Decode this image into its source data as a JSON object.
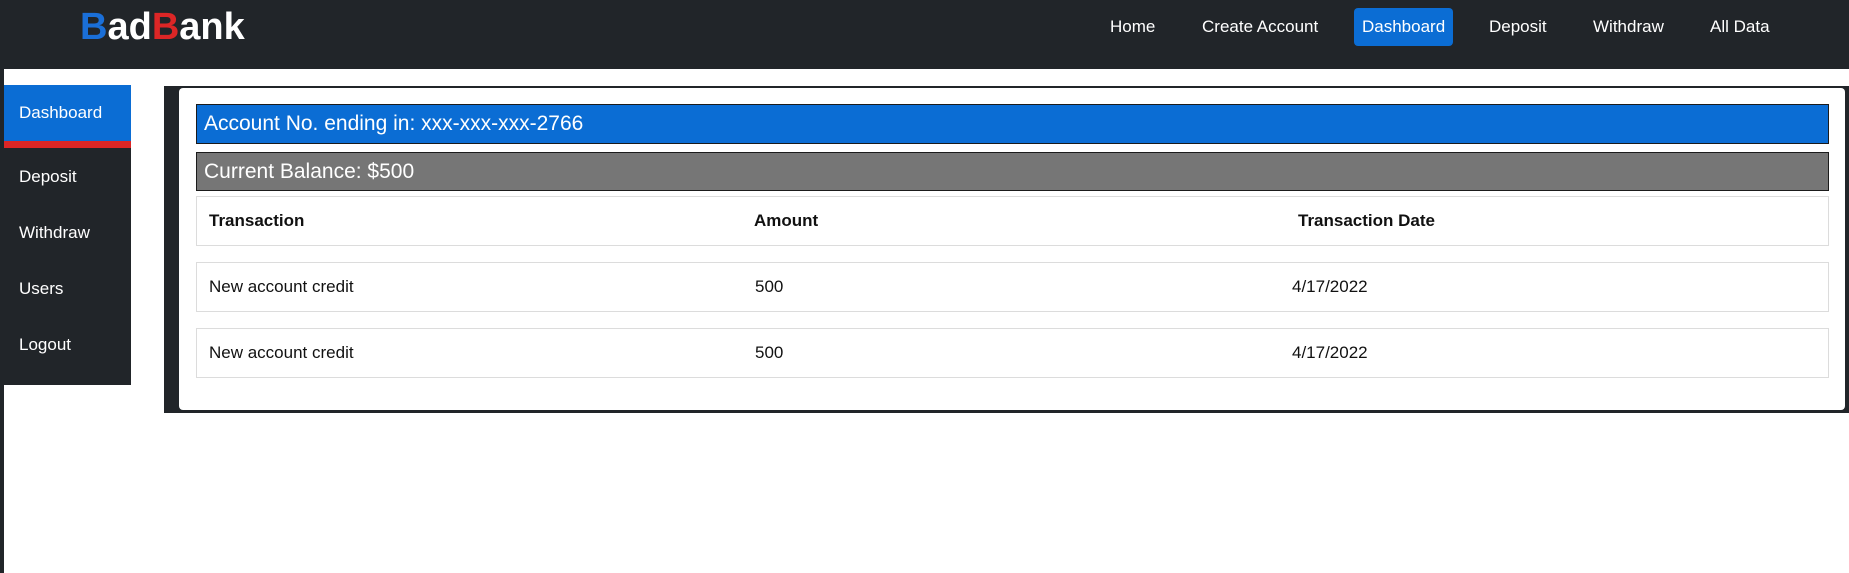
{
  "brand": {
    "part1": "B",
    "part2": "ad",
    "part3": "B",
    "part4": "ank",
    "color_first_b": "#1a6fd8",
    "color_second_b": "#dc2626"
  },
  "nav": {
    "items": [
      {
        "label": "Home"
      },
      {
        "label": "Create Account"
      },
      {
        "label": "Dashboard",
        "active": true
      },
      {
        "label": "Deposit"
      },
      {
        "label": "Withdraw"
      },
      {
        "label": "All Data"
      }
    ]
  },
  "sidebar": {
    "items": [
      {
        "label": "Dashboard",
        "active": true
      },
      {
        "label": "Deposit"
      },
      {
        "label": "Withdraw"
      },
      {
        "label": "Users"
      },
      {
        "label": "Logout"
      }
    ]
  },
  "account": {
    "label": "Account No. ending in: xxx-xxx-xxx-2766",
    "balance_label": "Current Balance: $500"
  },
  "table": {
    "headers": [
      "Transaction",
      "Amount",
      "Transaction Date"
    ],
    "rows": [
      [
        "New account credit",
        "500",
        "4/17/2022"
      ],
      [
        "New account credit",
        "500",
        "4/17/2022"
      ]
    ]
  },
  "colors": {
    "navbar_bg": "#212529",
    "accent_blue": "#0b6dd4",
    "accent_red": "#dc2626",
    "balance_gray": "#767676"
  }
}
